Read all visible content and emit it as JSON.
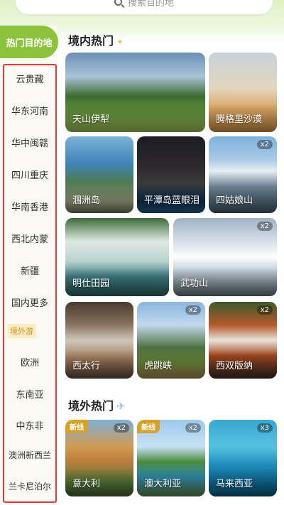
{
  "search": {
    "placeholder": "搜索目的地"
  },
  "sidebar": {
    "header": "热门目的地",
    "items": [
      "云贵藏",
      "华东河南",
      "华中闽赣",
      "四川重庆",
      "华南香港",
      "西北内蒙",
      "新疆",
      "国内更多"
    ],
    "section_label": "境外游",
    "abroad_items": [
      "欧洲",
      "东南亚",
      "中东非",
      "澳洲新西兰",
      "兰卡尼泊尔"
    ]
  },
  "domestic": {
    "title": "境内热门",
    "cards": [
      {
        "label": "天山伊犁",
        "badge": ""
      },
      {
        "label": "腾格里沙漠",
        "badge": ""
      },
      {
        "label": "涠洲岛",
        "badge": ""
      },
      {
        "label": "平潭岛蓝眼泪",
        "badge": ""
      },
      {
        "label": "四姑娘山",
        "badge": "x2"
      },
      {
        "label": "明仕田园",
        "badge": ""
      },
      {
        "label": "武功山",
        "badge": "x2"
      },
      {
        "label": "西太行",
        "badge": ""
      },
      {
        "label": "虎跳峡",
        "badge": "x2"
      },
      {
        "label": "西双版纳",
        "badge": "x2"
      }
    ]
  },
  "abroad": {
    "title": "境外热门",
    "cards": [
      {
        "label": "意大利",
        "badge": "x2",
        "tag": "新线"
      },
      {
        "label": "澳大利亚",
        "badge": "x2",
        "tag": "新线"
      },
      {
        "label": "马来西亚",
        "badge": "x3",
        "tag": ""
      }
    ]
  }
}
